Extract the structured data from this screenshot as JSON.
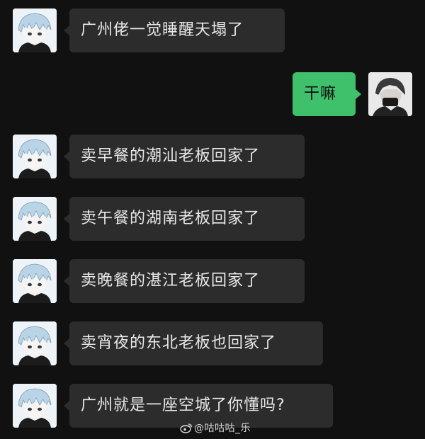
{
  "messages": [
    {
      "side": "left",
      "text": "广州佬一觉睡醒天塌了"
    },
    {
      "side": "right",
      "text": "干嘛"
    },
    {
      "side": "left",
      "text": "卖早餐的潮汕老板回家了"
    },
    {
      "side": "left",
      "text": "卖午餐的湖南老板回家了"
    },
    {
      "side": "left",
      "text": "卖晚餐的湛江老板回家了"
    },
    {
      "side": "left",
      "text": "卖宵夜的东北老板也回家了"
    },
    {
      "side": "left",
      "text": "广州就是一座空城了你懂吗?"
    }
  ],
  "watermark": {
    "icon": "weibo-icon",
    "text": "@咕咕咕_乐"
  },
  "colors": {
    "background": "#111111",
    "incoming_bubble": "#2c2c2c",
    "outgoing_bubble": "#3fc06a"
  }
}
